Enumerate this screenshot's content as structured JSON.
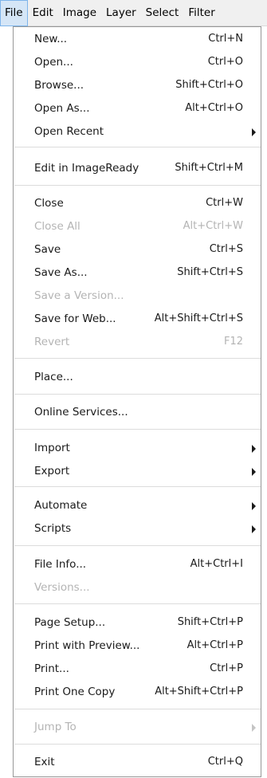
{
  "menubar": [
    "File",
    "Edit",
    "Image",
    "Layer",
    "Select",
    "Filter"
  ],
  "menu": {
    "new": {
      "label": "New...",
      "shortcut": "Ctrl+N"
    },
    "open": {
      "label": "Open...",
      "shortcut": "Ctrl+O"
    },
    "browse": {
      "label": "Browse...",
      "shortcut": "Shift+Ctrl+O"
    },
    "open_as": {
      "label": "Open As...",
      "shortcut": "Alt+Ctrl+O"
    },
    "open_recent": {
      "label": "Open Recent"
    },
    "edit_in_imageready": {
      "label": "Edit in ImageReady",
      "shortcut": "Shift+Ctrl+M"
    },
    "close": {
      "label": "Close",
      "shortcut": "Ctrl+W"
    },
    "close_all": {
      "label": "Close All",
      "shortcut": "Alt+Ctrl+W"
    },
    "save": {
      "label": "Save",
      "shortcut": "Ctrl+S"
    },
    "save_as": {
      "label": "Save As...",
      "shortcut": "Shift+Ctrl+S"
    },
    "save_a_version": {
      "label": "Save a Version..."
    },
    "save_for_web": {
      "label": "Save for Web...",
      "shortcut": "Alt+Shift+Ctrl+S"
    },
    "revert": {
      "label": "Revert",
      "shortcut": "F12"
    },
    "place": {
      "label": "Place..."
    },
    "online_services": {
      "label": "Online Services..."
    },
    "import": {
      "label": "Import"
    },
    "export": {
      "label": "Export"
    },
    "automate": {
      "label": "Automate"
    },
    "scripts": {
      "label": "Scripts"
    },
    "file_info": {
      "label": "File Info...",
      "shortcut": "Alt+Ctrl+I"
    },
    "versions": {
      "label": "Versions..."
    },
    "page_setup": {
      "label": "Page Setup...",
      "shortcut": "Shift+Ctrl+P"
    },
    "print_with_preview": {
      "label": "Print with Preview...",
      "shortcut": "Alt+Ctrl+P"
    },
    "print": {
      "label": "Print...",
      "shortcut": "Ctrl+P"
    },
    "print_one_copy": {
      "label": "Print One Copy",
      "shortcut": "Alt+Shift+Ctrl+P"
    },
    "jump_to": {
      "label": "Jump To"
    },
    "exit": {
      "label": "Exit",
      "shortcut": "Ctrl+Q"
    }
  },
  "icons": {
    "submenu": "chevron-right-icon"
  },
  "colors": {
    "highlight": "#d5e6f7",
    "highlight_border": "#7eb4ea",
    "disabled_text": "#b4b4b4"
  }
}
